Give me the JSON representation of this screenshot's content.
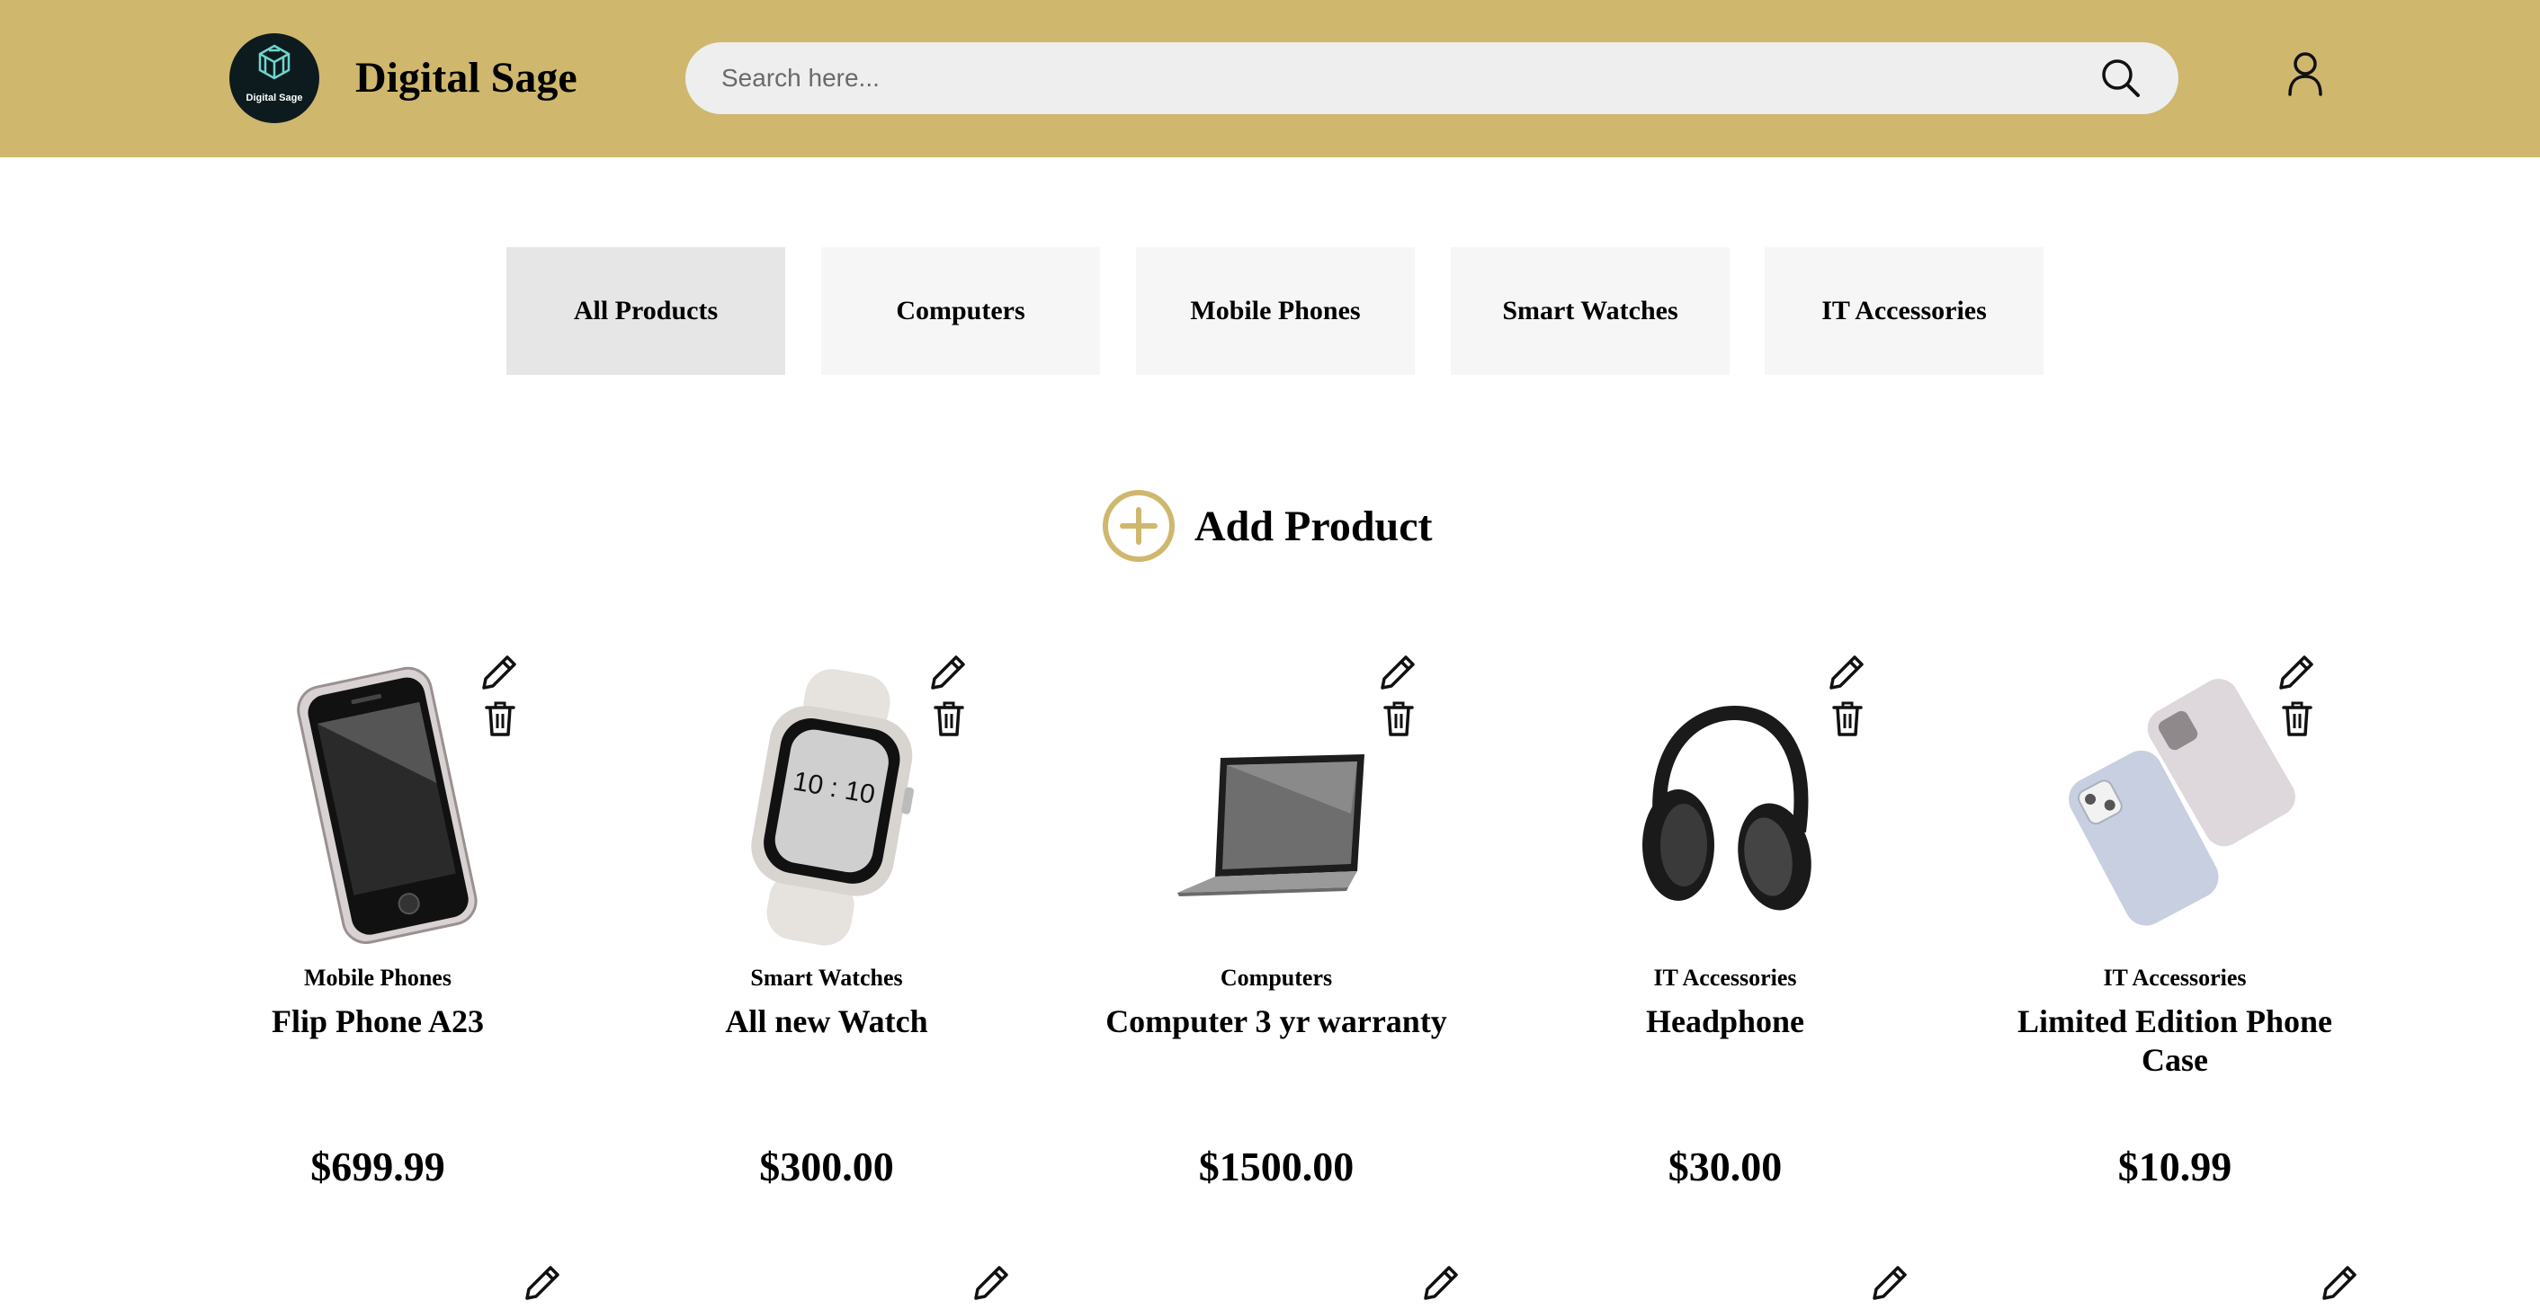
{
  "header": {
    "logo_text": "Digital Sage",
    "brand": "Digital Sage",
    "search_placeholder": "Search here...",
    "accent_color": "#cfb76e"
  },
  "tabs": [
    {
      "label": "All Products",
      "active": true
    },
    {
      "label": "Computers",
      "active": false
    },
    {
      "label": "Mobile Phones",
      "active": false
    },
    {
      "label": "Smart Watches",
      "active": false
    },
    {
      "label": "IT Accessories",
      "active": false
    }
  ],
  "add_product": {
    "label": "Add Product",
    "icon": "plus-circle-icon"
  },
  "products": [
    {
      "category": "Mobile Phones",
      "name": "Flip Phone A23",
      "price": "$699.99",
      "image": "phone-image"
    },
    {
      "category": "Smart Watches",
      "name": "All new Watch",
      "price": "$300.00",
      "image": "watch-image",
      "watch_time": "10 : 10"
    },
    {
      "category": "Computers",
      "name": "Computer 3 yr warranty",
      "price": "$1500.00",
      "image": "laptop-image"
    },
    {
      "category": "IT Accessories",
      "name": "Headphone",
      "price": "$30.00",
      "image": "headphone-image"
    },
    {
      "category": "IT Accessories",
      "name": "Limited Edition Phone Case",
      "price": "$10.99",
      "image": "phone-case-image"
    }
  ]
}
